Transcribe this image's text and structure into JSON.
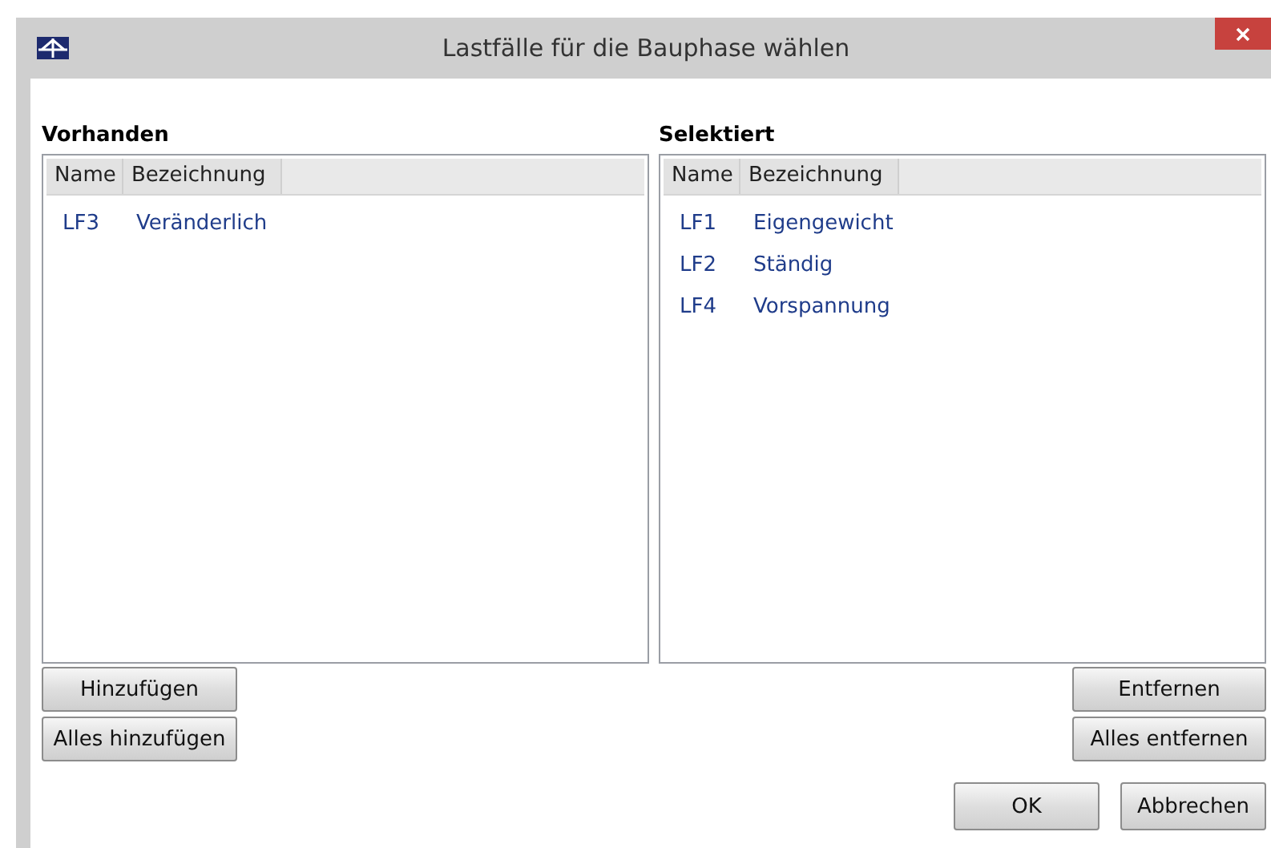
{
  "window": {
    "title": "Lastfälle für die Bauphase wählen"
  },
  "available": {
    "label": "Vorhanden",
    "columns": [
      "Name",
      "Bezeichnung"
    ],
    "rows": [
      {
        "name": "LF3",
        "description": "Veränderlich"
      }
    ],
    "buttons": [
      "Hinzufügen",
      "Alles hinzufügen"
    ]
  },
  "selected": {
    "label": "Selektiert",
    "columns": [
      "Name",
      "Bezeichnung"
    ],
    "rows": [
      {
        "name": "LF1",
        "description": "Eigengewicht"
      },
      {
        "name": "LF2",
        "description": "Ständig"
      },
      {
        "name": "LF4",
        "description": "Vorspannung"
      }
    ],
    "buttons": [
      "Entfernen",
      "Alles entfernen"
    ]
  },
  "buttons": [
    "OK",
    "Abbrechen"
  ]
}
